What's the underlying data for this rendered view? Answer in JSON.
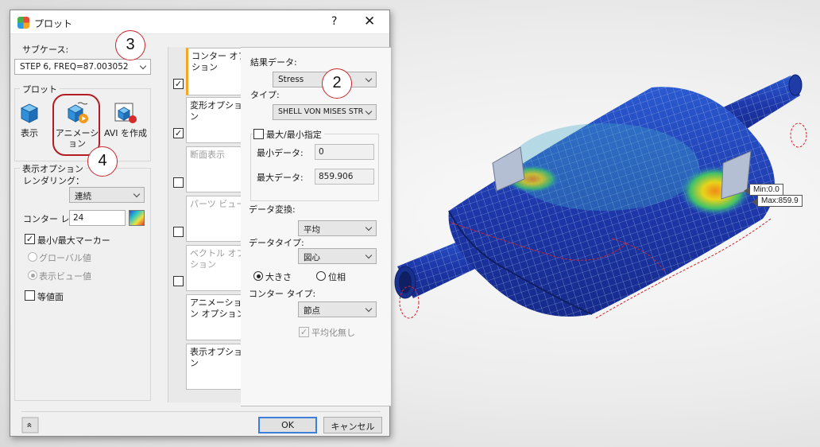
{
  "dialog": {
    "title": "プロット",
    "help": "?",
    "close": "✕"
  },
  "subcase": {
    "label": "サブケース:",
    "value": "STEP 6, FREQ=87.003052"
  },
  "plot_group": {
    "title": "プロット",
    "tools": [
      {
        "label": "表示",
        "icon": "display-cube-icon"
      },
      {
        "label": "アニメーション",
        "icon": "animation-icon"
      },
      {
        "label": "AVI を作成",
        "icon": "avi-record-icon"
      }
    ]
  },
  "display_options": {
    "title": "表示オプション",
    "rendering_label": "レンダリング：",
    "rendering_value": "連続",
    "contour_label": "コンター レ",
    "contour_value": "24",
    "minmax_marker_label": "最小/最大マーカー",
    "minmax_marker_checked": true,
    "global_label": "グローバル値",
    "view_label": "表示ビュー値",
    "isovalue_label": "等値面",
    "isovalue_checked": false
  },
  "tabs": [
    {
      "label": "コンター オプション",
      "checked": true,
      "enabled": true,
      "selected": true
    },
    {
      "label": "変形オプション",
      "checked": true,
      "enabled": true,
      "selected": false
    },
    {
      "label": "断面表示",
      "checked": false,
      "enabled": false,
      "selected": false
    },
    {
      "label": "パーツ ビュー",
      "checked": false,
      "enabled": false,
      "selected": false
    },
    {
      "label": "ベクトル オプション",
      "checked": false,
      "enabled": false,
      "selected": false
    },
    {
      "label": "アニメーション オプション",
      "checked": null,
      "enabled": true,
      "selected": false
    },
    {
      "label": "表示オプション",
      "checked": null,
      "enabled": true,
      "selected": false
    }
  ],
  "contour": {
    "result_label": "結果データ:",
    "result_value": "Stress",
    "type_label": "タイプ:",
    "type_value": "SHELL VON MISES STR",
    "minmax_label": "最大/最小指定",
    "minmax_checked": false,
    "min_label": "最小データ:",
    "min_value": "0",
    "max_label": "最大データ:",
    "max_value": "859.906",
    "transform_label": "データ変換:",
    "transform_value": "平均",
    "datatype_label": "データタイプ:",
    "datatype_value": "図心",
    "magnitude_label": "大きさ",
    "phase_label": "位相",
    "contour_type_label": "コンター タイプ:",
    "contour_type_value": "節点",
    "no_average_label": "平均化無し",
    "no_average_checked": true
  },
  "buttons": {
    "ok": "OK",
    "cancel": "キャンセル",
    "collapse": "»"
  },
  "callouts": [
    "3",
    "2",
    "4"
  ],
  "model_labels": {
    "min": "Min:0.0",
    "max": "Max:859.9"
  },
  "colors": {
    "accent_tab": "#f5a623",
    "callout_ring": "#c8272b",
    "mesh_blue": "#1f3fb0",
    "hot_spot": "#e8c21a"
  }
}
